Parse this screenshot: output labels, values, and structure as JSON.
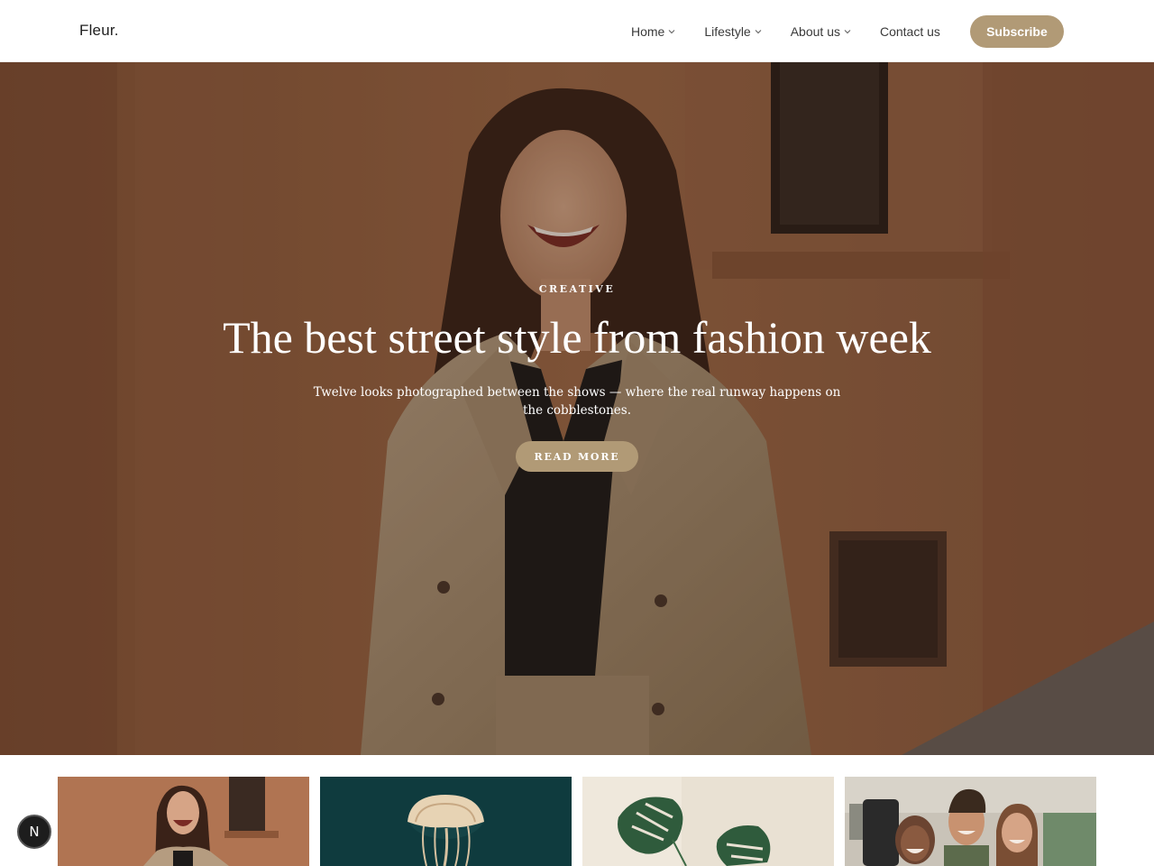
{
  "brand": {
    "name": "Fleur.",
    "accent": "#b19a76"
  },
  "nav": {
    "items": [
      {
        "label": "Home",
        "has_dropdown": true
      },
      {
        "label": "Lifestyle",
        "has_dropdown": true
      },
      {
        "label": "About us",
        "has_dropdown": true
      },
      {
        "label": "Contact us",
        "has_dropdown": false
      }
    ],
    "subscribe_label": "Subscribe"
  },
  "hero": {
    "category": "CREATIVE",
    "title": "The best street style from fashion week",
    "description": "Twelve looks photographed between the shows — where the real runway happens on the cobblestones.",
    "cta_label": "READ MORE",
    "image": "laughing woman in beige blazer against terracotta wall"
  },
  "cards": [
    {
      "image": "laughing woman in beige blazer"
    },
    {
      "image": "jellyfish in dark teal water"
    },
    {
      "image": "monstera plant leaves"
    },
    {
      "image": "group of friends taking a selfie"
    }
  ],
  "floating_badge": {
    "label": "N"
  }
}
